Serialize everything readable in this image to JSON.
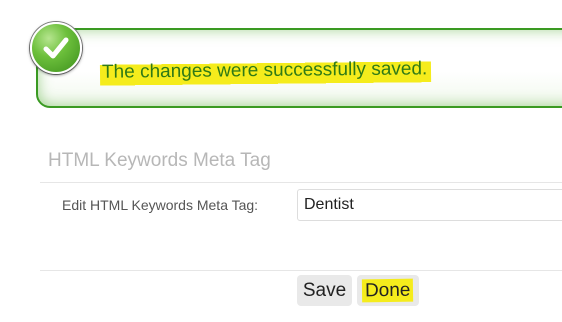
{
  "banner": {
    "message": "The changes were successfully saved.",
    "icon": "checkmark-icon",
    "accent_color": "#3a9a22",
    "text_color": "#2f7a16",
    "highlight_color": "#f5ec1c"
  },
  "section": {
    "title": "HTML Keywords Meta Tag"
  },
  "form": {
    "field_label": "Edit HTML Keywords Meta Tag:",
    "field_value": "Dentist"
  },
  "actions": {
    "save_label": "Save",
    "done_label": "Done"
  }
}
